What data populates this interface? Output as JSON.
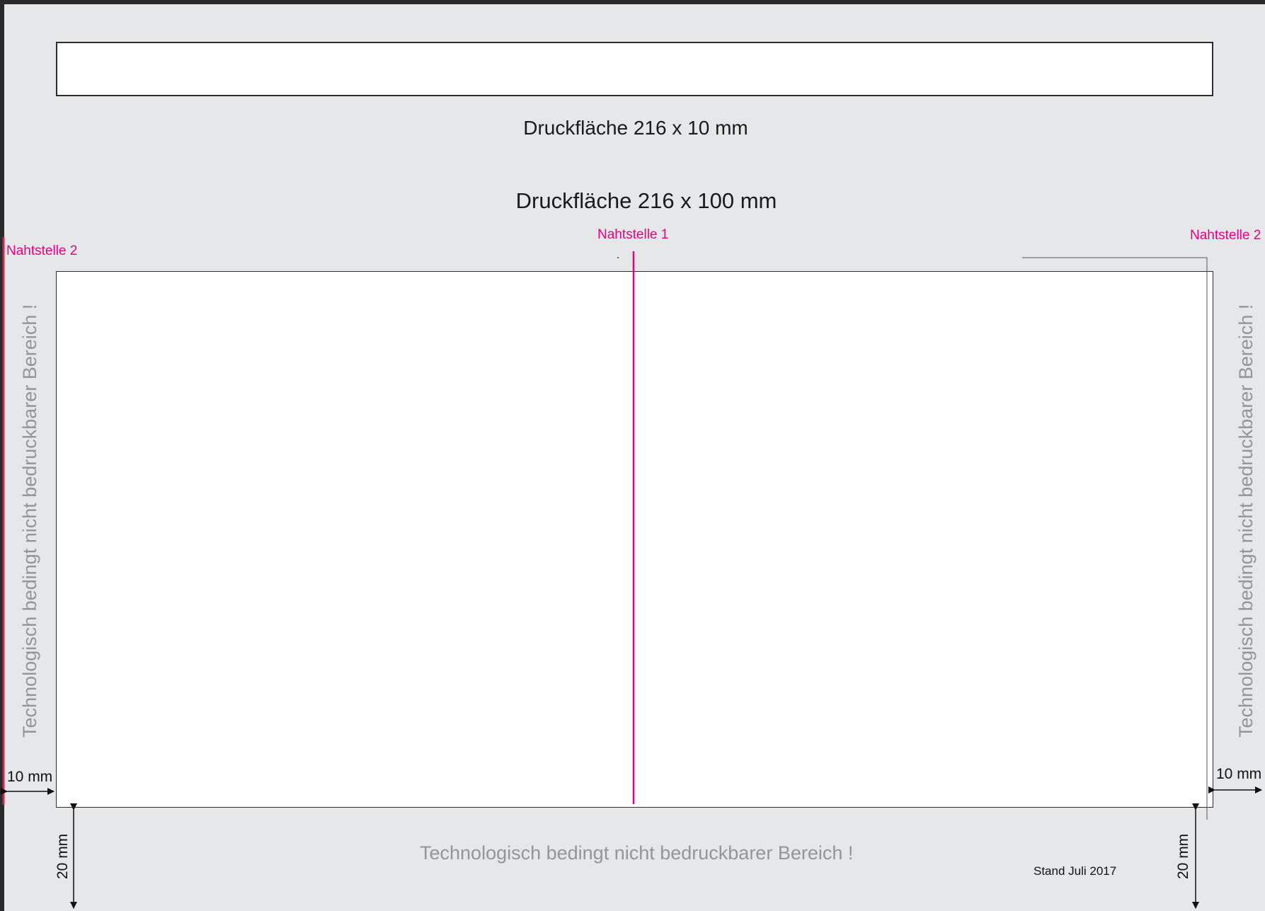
{
  "top_area": {
    "label": "Druckfläche 216 x 10 mm"
  },
  "main_area": {
    "label": "Druckfläche 216 x 100 mm"
  },
  "seams": {
    "left_label": "Nahtstelle 2",
    "center_label": "Nahtstelle 1",
    "right_label": "Nahtstelle 2"
  },
  "notes": {
    "left_vertical": "Technologisch bedingt nicht bedruckbarer Bereich !",
    "right_vertical": "Technologisch bedingt nicht bedruckbarer Bereich !",
    "bottom": "Technologisch bedingt nicht bedruckbarer Bereich !"
  },
  "dimensions": {
    "left_margin": "10 mm",
    "right_margin": "10 mm",
    "bottom_left": "20 mm",
    "bottom_right": "20 mm"
  },
  "stand": "Stand Juli 2017",
  "colors": {
    "seam": "#e6007e",
    "left_seam": "#d6264f",
    "background": "#e6e7e8",
    "note_text": "#939598"
  }
}
